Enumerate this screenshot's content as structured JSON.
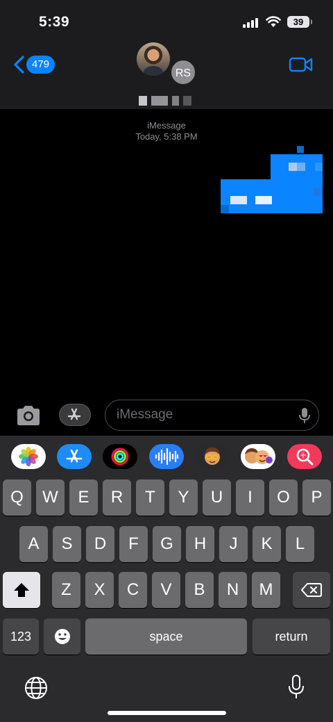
{
  "status_bar": {
    "time": "5:39",
    "battery": "39"
  },
  "header": {
    "back_count": "479",
    "avatar_initials": "RS"
  },
  "conversation": {
    "service": "iMessage",
    "timestamp": "Today, 5:38 PM"
  },
  "input": {
    "placeholder": "iMessage"
  },
  "colors": {
    "accent": "#0a84ff",
    "keyboard_bg": "#2b2b2d",
    "key": "#6b6b6e",
    "special_key": "#464649"
  },
  "app_strip": [
    "photos-icon",
    "app-store-icon",
    "activity-icon",
    "audio-message-icon",
    "memoji-icon",
    "memoji-stickers-icon",
    "image-search-icon"
  ],
  "keyboard": {
    "row1": [
      "Q",
      "W",
      "E",
      "R",
      "T",
      "Y",
      "U",
      "I",
      "O",
      "P"
    ],
    "row2": [
      "A",
      "S",
      "D",
      "F",
      "G",
      "H",
      "J",
      "K",
      "L"
    ],
    "row3": [
      "Z",
      "X",
      "C",
      "V",
      "B",
      "N",
      "M"
    ],
    "numbers_key": "123",
    "space_key": "space",
    "return_key": "return"
  }
}
